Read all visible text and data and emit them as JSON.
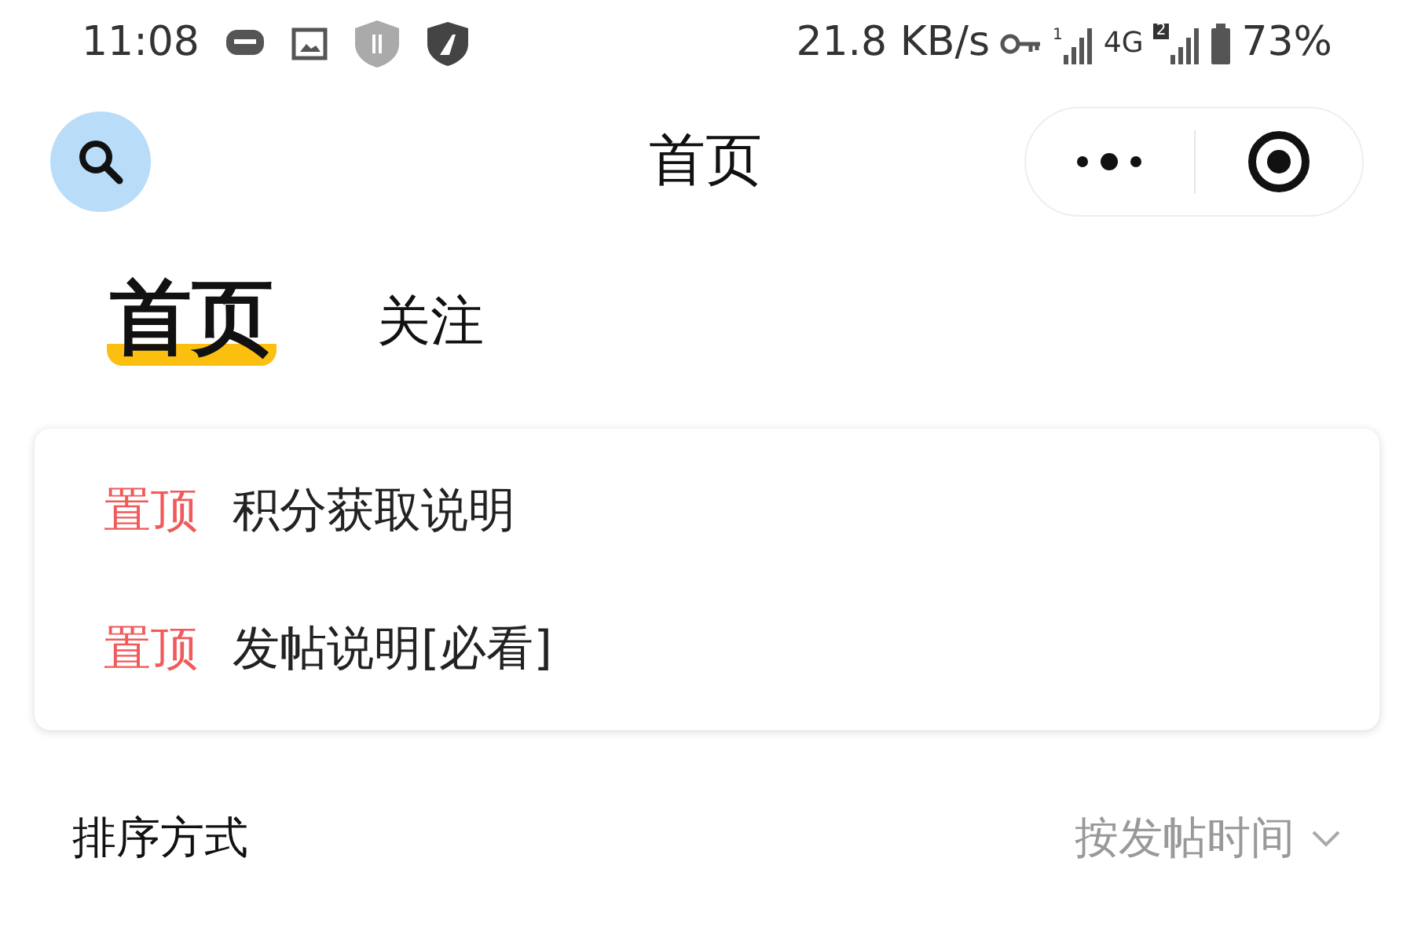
{
  "status_bar": {
    "time": "11:08",
    "speed": "21.8 KB/s",
    "sim_1": "1",
    "network": "4G",
    "sim_2": "2",
    "battery": "73%"
  },
  "nav_bar": {
    "title": "首页"
  },
  "tabs": [
    {
      "label": "首页",
      "selected": true
    },
    {
      "label": "关注",
      "selected": false
    }
  ],
  "pinned": [
    {
      "badge": "置顶",
      "title": "积分获取说明"
    },
    {
      "badge": "置顶",
      "title": "发帖说明[必看]"
    }
  ],
  "sort": {
    "label": "排序方式",
    "value": "按发帖时间"
  }
}
